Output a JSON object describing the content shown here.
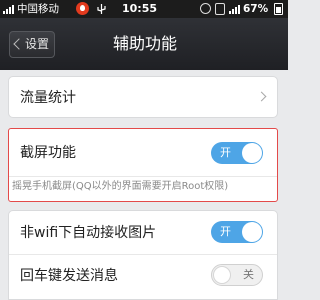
{
  "status_bar": {
    "carrier": "中国移动",
    "time": "10:55",
    "battery": "67%",
    "icons": [
      "signal-icon",
      "qq-icon",
      "usb-icon",
      "alarm-icon",
      "vibrate-icon",
      "signal-icon",
      "battery-icon"
    ]
  },
  "header": {
    "back_label": "设置",
    "title": "辅助功能"
  },
  "settings": {
    "traffic_stats": {
      "label": "流量统计"
    },
    "screenshot": {
      "label": "截屏功能",
      "toggle_label": "开",
      "enabled": true,
      "description": "摇晃手机截屏(QQ以外的界面需要开启Root权限)"
    },
    "non_wifi_images": {
      "label": "非wifi下自动接收图片",
      "toggle_label": "开",
      "enabled": true
    },
    "enter_send": {
      "label": "回车键发送消息",
      "toggle_label": "关",
      "enabled": false
    }
  },
  "colors": {
    "toggle_on": "#4ea5e6",
    "highlight_border": "#e34a4a",
    "title_bar": "#2a2b2f"
  }
}
